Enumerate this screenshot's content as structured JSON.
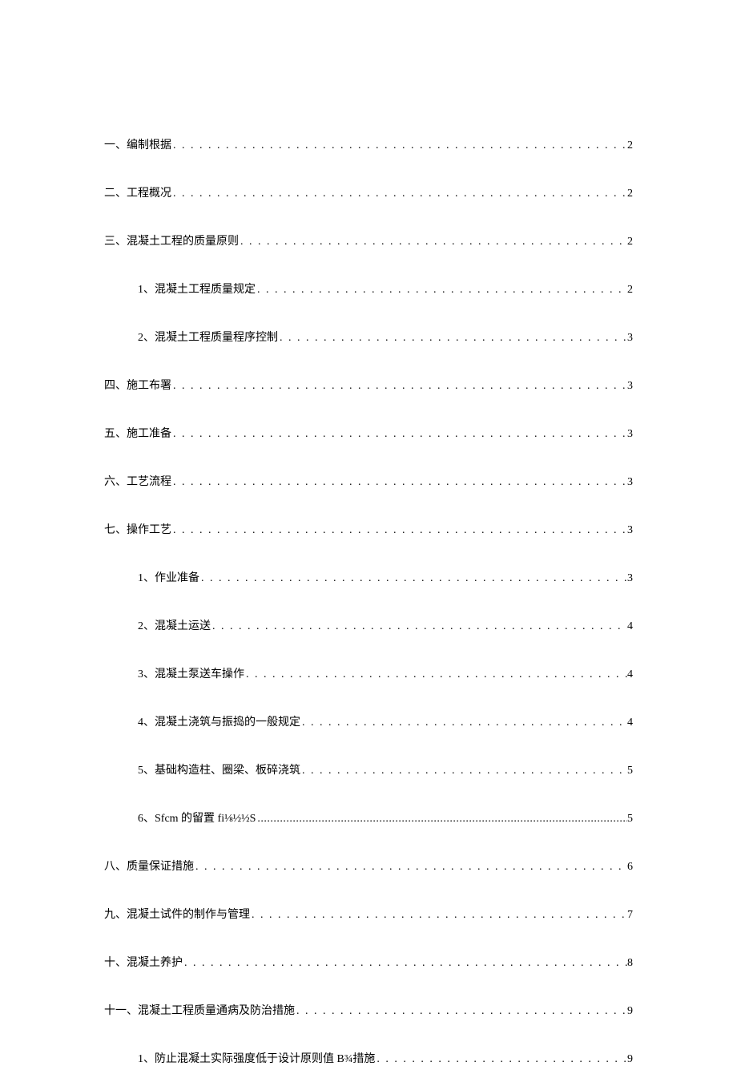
{
  "toc": [
    {
      "label": "一、编制根据",
      "page": "2",
      "indent": 0,
      "tight": false
    },
    {
      "label": "二、工程概况",
      "page": "2",
      "indent": 0,
      "tight": false
    },
    {
      "label": "三、混凝土工程的质量原则",
      "page": "2",
      "indent": 0,
      "tight": false
    },
    {
      "label": "1、混凝土工程质量规定",
      "page": "2",
      "indent": 1,
      "tight": false
    },
    {
      "label": "2、混凝土工程质量程序控制",
      "page": "3",
      "indent": 1,
      "tight": false
    },
    {
      "label": "四、施工布署",
      "page": "3",
      "indent": 0,
      "tight": false
    },
    {
      "label": "五、施工准备",
      "page": "3",
      "indent": 0,
      "tight": false
    },
    {
      "label": "六、工艺流程",
      "page": "3",
      "indent": 0,
      "tight": false
    },
    {
      "label": "七、操作工艺",
      "page": "3",
      "indent": 0,
      "tight": false
    },
    {
      "label": "1、作业准备",
      "page": "3",
      "indent": 1,
      "tight": false
    },
    {
      "label": "2、混凝土运送",
      "page": "4",
      "indent": 1,
      "tight": false
    },
    {
      "label": "3、混凝土泵送车操作",
      "page": "4",
      "indent": 1,
      "tight": false
    },
    {
      "label": "4、混凝土浇筑与振捣的一般规定",
      "page": "4",
      "indent": 1,
      "tight": false
    },
    {
      "label": "5、基础构造柱、圈梁、板碎浇筑",
      "page": "5",
      "indent": 1,
      "tight": false
    },
    {
      "label": "6、Sfcm 的留置 fi⅛½½S",
      "page": "5",
      "indent": 1,
      "tight": true
    },
    {
      "label": "八、质量保证措施",
      "page": "6",
      "indent": 0,
      "tight": false
    },
    {
      "label": "九、混凝土试件的制作与管理",
      "page": "7",
      "indent": 0,
      "tight": false
    },
    {
      "label": "十、混凝土养护",
      "page": "8",
      "indent": 0,
      "tight": false
    },
    {
      "label": "十一、混凝土工程质量通病及防治措施",
      "page": "9",
      "indent": 0,
      "tight": false
    },
    {
      "label": "1、防止混凝土实际强度低于设计原则值 B¾措施",
      "page": "9",
      "indent": 1,
      "tight": false
    }
  ]
}
